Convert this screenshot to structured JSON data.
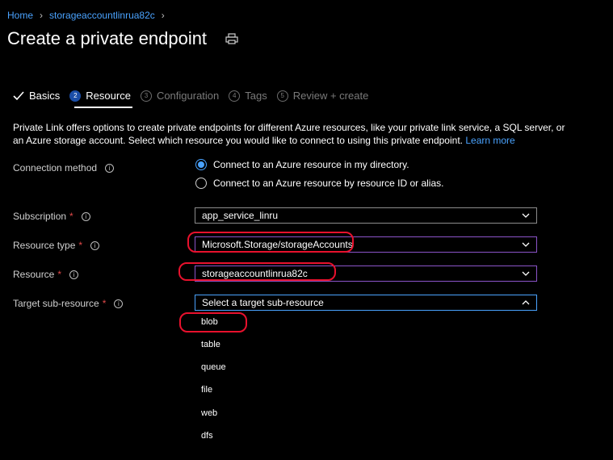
{
  "breadcrumb": {
    "home": "Home",
    "account": "storageaccountlinrua82c"
  },
  "page": {
    "title": "Create a private endpoint"
  },
  "steps": [
    {
      "num": "",
      "label": "Basics"
    },
    {
      "num": "2",
      "label": "Resource"
    },
    {
      "num": "3",
      "label": "Configuration"
    },
    {
      "num": "4",
      "label": "Tags"
    },
    {
      "num": "5",
      "label": "Review + create"
    }
  ],
  "description": {
    "text": "Private Link offers options to create private endpoints for different Azure resources, like your private link service, a SQL server, or an Azure storage account. Select which resource you would like to connect to using this private endpoint.",
    "learn_more": "Learn more"
  },
  "form": {
    "connection_method": {
      "label": "Connection method",
      "options": [
        "Connect to an Azure resource in my directory.",
        "Connect to an Azure resource by resource ID or alias."
      ],
      "selected": 0
    },
    "subscription": {
      "label": "Subscription",
      "value": "app_service_linru"
    },
    "resource_type": {
      "label": "Resource type",
      "value": "Microsoft.Storage/storageAccounts"
    },
    "resource": {
      "label": "Resource",
      "value": "storageaccountlinrua82c"
    },
    "target_sub_resource": {
      "label": "Target sub-resource",
      "placeholder": "Select a target sub-resource",
      "options": [
        "blob",
        "table",
        "queue",
        "file",
        "web",
        "dfs"
      ]
    }
  },
  "colors": {
    "accent": "#4aa3ff",
    "required": "#e04848",
    "highlight": "#e8112d",
    "invalid_border": "#8b54c9"
  }
}
